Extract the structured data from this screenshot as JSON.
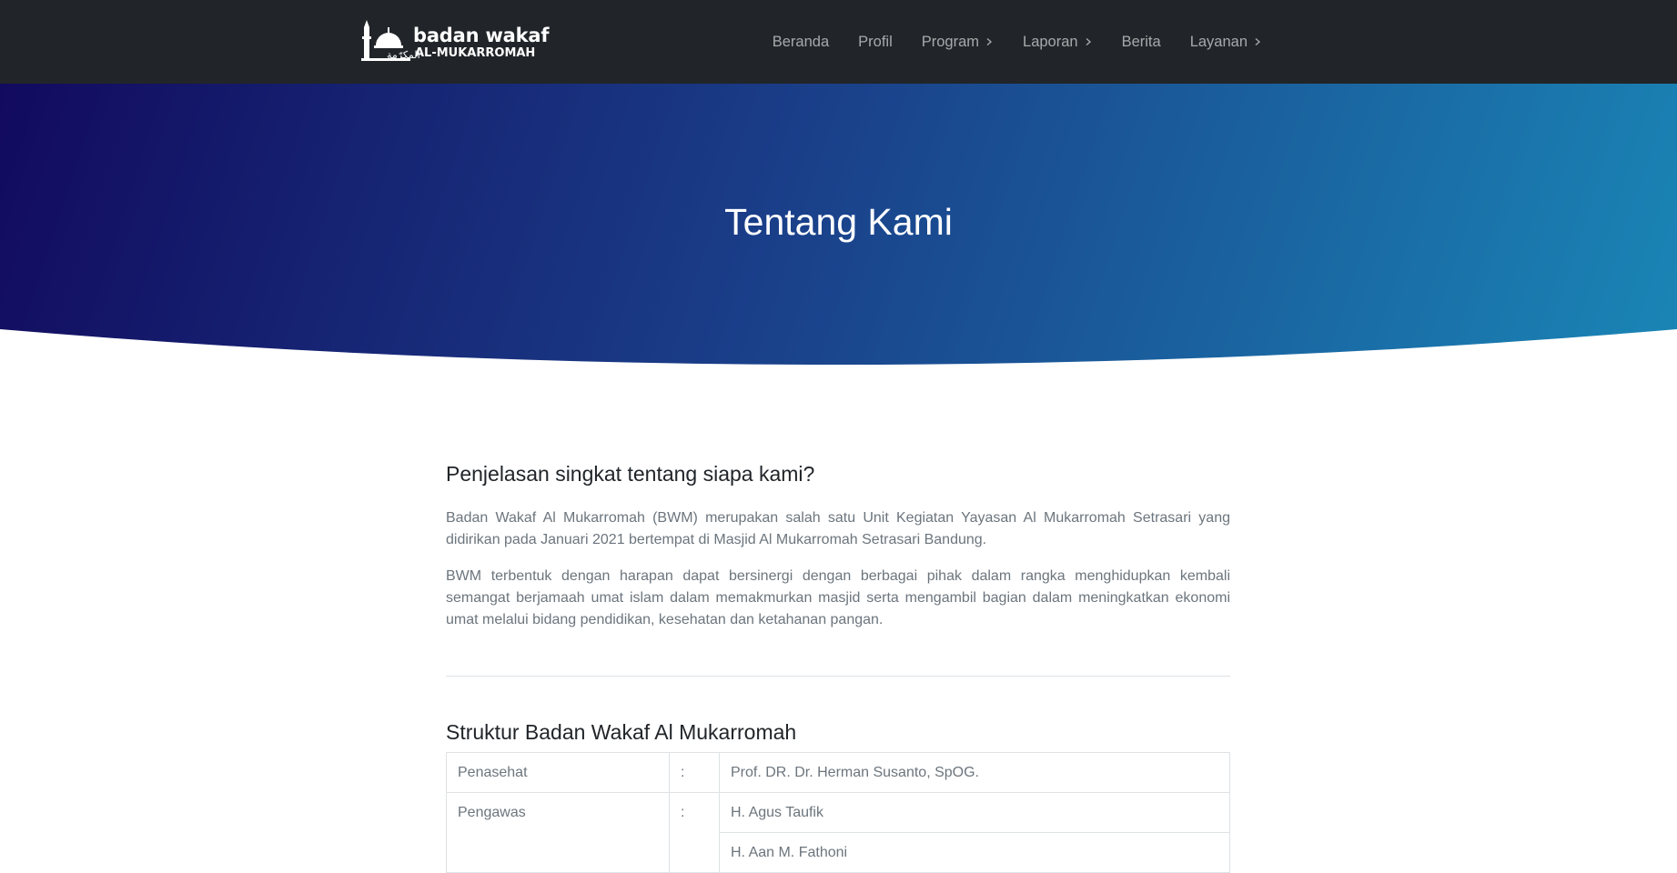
{
  "brand": {
    "line1": "badan wakaf",
    "line2": "AL-MUKARROMAH",
    "arabic": "المكرّمة"
  },
  "nav": {
    "items": [
      {
        "label": "Beranda",
        "dropdown": false
      },
      {
        "label": "Profil",
        "dropdown": false
      },
      {
        "label": "Program",
        "dropdown": true
      },
      {
        "label": "Laporan",
        "dropdown": true
      },
      {
        "label": "Berita",
        "dropdown": false
      },
      {
        "label": "Layanan",
        "dropdown": true
      }
    ]
  },
  "hero": {
    "title": "Tentang Kami"
  },
  "about": {
    "heading": "Penjelasan singkat tentang siapa kami?",
    "paragraphs": [
      "Badan Wakaf Al Mukarromah (BWM) merupakan salah satu Unit Kegiatan Yayasan Al Mukarromah Setrasari yang didirikan pada Januari 2021 bertempat di Masjid Al Mukarromah Setrasari Bandung.",
      "BWM terbentuk dengan harapan dapat bersinergi dengan berbagai pihak dalam rangka menghidupkan kembali semangat berjamaah umat islam dalam memakmurkan masjid serta mengambil bagian dalam meningkatkan ekonomi umat melalui bidang pendidikan, kesehatan dan ketahanan pangan."
    ]
  },
  "structure": {
    "heading": "Struktur Badan Wakaf Al Mukarromah",
    "separator": ":",
    "rows": [
      {
        "role": "Penasehat",
        "names": [
          "Prof. DR. Dr. Herman Susanto, SpOG."
        ]
      },
      {
        "role": "Pengawas",
        "names": [
          "H. Agus Taufik",
          "H. Aan M. Fathoni"
        ]
      }
    ]
  },
  "colors": {
    "navbar": "#212529",
    "hero_start": "#120a5e",
    "hero_end": "#1a86b6",
    "body_text": "#6c757d"
  }
}
